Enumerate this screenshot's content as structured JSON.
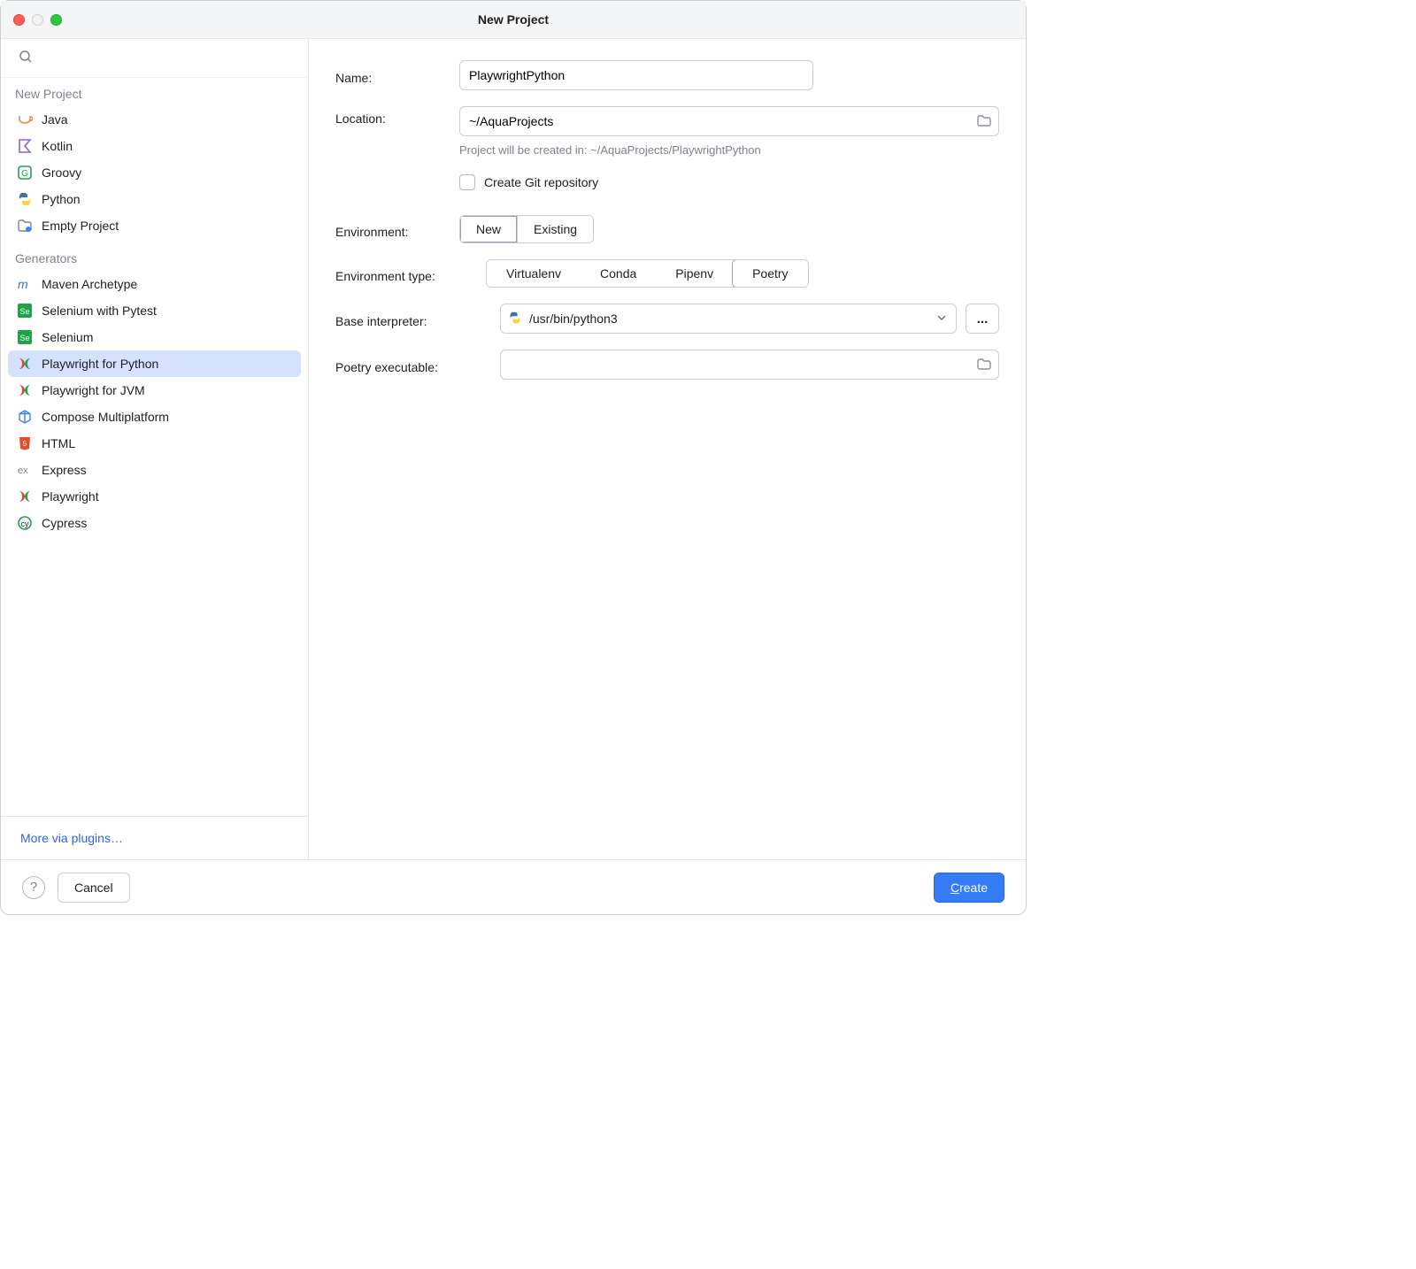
{
  "window": {
    "title": "New Project"
  },
  "sidebar": {
    "groups": [
      {
        "label": "New Project",
        "items": [
          {
            "id": "java",
            "label": "Java"
          },
          {
            "id": "kotlin",
            "label": "Kotlin"
          },
          {
            "id": "groovy",
            "label": "Groovy"
          },
          {
            "id": "python",
            "label": "Python"
          },
          {
            "id": "empty",
            "label": "Empty Project"
          }
        ]
      },
      {
        "label": "Generators",
        "items": [
          {
            "id": "maven",
            "label": "Maven Archetype"
          },
          {
            "id": "selenium-pytest",
            "label": "Selenium with Pytest"
          },
          {
            "id": "selenium",
            "label": "Selenium"
          },
          {
            "id": "playwright-python",
            "label": "Playwright for Python",
            "selected": true
          },
          {
            "id": "playwright-jvm",
            "label": "Playwright for JVM"
          },
          {
            "id": "compose",
            "label": "Compose Multiplatform"
          },
          {
            "id": "html",
            "label": "HTML"
          },
          {
            "id": "express",
            "label": "Express"
          },
          {
            "id": "playwright",
            "label": "Playwright"
          },
          {
            "id": "cypress",
            "label": "Cypress"
          }
        ]
      }
    ],
    "moreLink": "More via plugins…"
  },
  "form": {
    "nameLabel": "Name:",
    "nameValue": "PlaywrightPython",
    "locationLabel": "Location:",
    "locationValue": "~/AquaProjects",
    "locationHint": "Project will be created in: ~/AquaProjects/PlaywrightPython",
    "gitLabel": "Create Git repository",
    "gitChecked": false,
    "envLabel": "Environment:",
    "envOptions": [
      "New",
      "Existing"
    ],
    "envSelected": "New",
    "envTypeLabel": "Environment type:",
    "envTypeOptions": [
      "Virtualenv",
      "Conda",
      "Pipenv",
      "Poetry"
    ],
    "envTypeSelected": "Poetry",
    "interpLabel": "Base interpreter:",
    "interpValue": "/usr/bin/python3",
    "dots": "...",
    "poetryLabel": "Poetry executable:",
    "poetryValue": ""
  },
  "footer": {
    "cancel": "Cancel",
    "create": "Create"
  }
}
